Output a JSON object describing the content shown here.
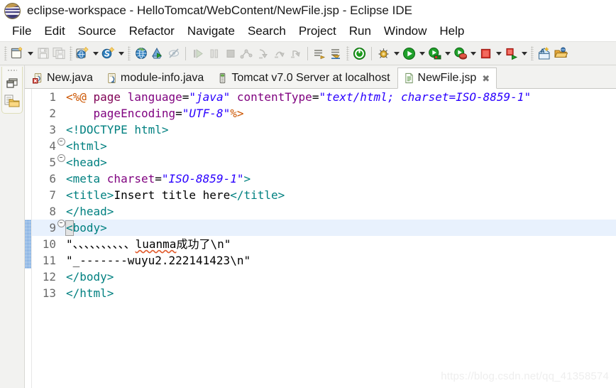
{
  "window": {
    "title": "eclipse-workspace - HelloTomcat/WebContent/NewFile.jsp - Eclipse IDE",
    "logo_name": "eclipse-logo"
  },
  "menubar": {
    "items": [
      {
        "label": "File"
      },
      {
        "label": "Edit"
      },
      {
        "label": "Source"
      },
      {
        "label": "Refactor"
      },
      {
        "label": "Navigate"
      },
      {
        "label": "Search"
      },
      {
        "label": "Project"
      },
      {
        "label": "Run"
      },
      {
        "label": "Window"
      },
      {
        "label": "Help"
      }
    ]
  },
  "toolbar": {
    "groups": [
      {
        "buttons": [
          {
            "icon": "new-wizard-icon",
            "enabled": true,
            "dropdown": true
          },
          {
            "icon": "save-icon",
            "enabled": false,
            "dropdown": false
          },
          {
            "icon": "save-all-icon",
            "enabled": false,
            "dropdown": false
          }
        ]
      },
      {
        "buttons": [
          {
            "icon": "new-jsp-file-icon",
            "enabled": true,
            "dropdown": true
          },
          {
            "icon": "new-servlet-icon",
            "enabled": true,
            "dropdown": true
          }
        ]
      },
      {
        "buttons": [
          {
            "icon": "open-web-browser-icon",
            "enabled": true,
            "dropdown": false
          },
          {
            "icon": "run-on-server-icon",
            "enabled": true,
            "dropdown": false
          },
          {
            "icon": "hide-annotations-icon",
            "enabled": false,
            "dropdown": false
          }
        ]
      },
      {
        "buttons": [
          {
            "icon": "resume-icon",
            "enabled": false,
            "dropdown": false
          },
          {
            "icon": "suspend-icon",
            "enabled": false,
            "dropdown": false
          },
          {
            "icon": "terminate-icon",
            "enabled": false,
            "dropdown": false
          },
          {
            "icon": "disconnect-icon",
            "enabled": false,
            "dropdown": false
          },
          {
            "icon": "step-into-icon",
            "enabled": false,
            "dropdown": false
          },
          {
            "icon": "step-over-icon",
            "enabled": false,
            "dropdown": false
          },
          {
            "icon": "step-return-icon",
            "enabled": false,
            "dropdown": false
          }
        ]
      },
      {
        "buttons": [
          {
            "icon": "next-annotation-icon",
            "enabled": true,
            "dropdown": false
          },
          {
            "icon": "previous-annotation-icon",
            "enabled": true,
            "dropdown": false
          }
        ]
      },
      {
        "buttons": [
          {
            "icon": "start-server-icon",
            "enabled": true,
            "dropdown": false
          }
        ]
      },
      {
        "buttons": [
          {
            "icon": "debug-icon",
            "enabled": true,
            "dropdown": true
          },
          {
            "icon": "run-icon",
            "enabled": true,
            "dropdown": true
          },
          {
            "icon": "run-server-icon",
            "enabled": true,
            "dropdown": true
          },
          {
            "icon": "profile-icon",
            "enabled": true,
            "dropdown": true
          },
          {
            "icon": "stop-icon",
            "enabled": true,
            "dropdown": true
          },
          {
            "icon": "publish-icon",
            "enabled": true,
            "dropdown": true
          }
        ]
      },
      {
        "buttons": [
          {
            "icon": "new-java-class-icon",
            "enabled": true,
            "dropdown": false
          },
          {
            "icon": "open-type-icon",
            "enabled": true,
            "dropdown": false
          }
        ]
      }
    ]
  },
  "leftbar": {
    "icons": [
      {
        "name": "restore-perspective-icon"
      },
      {
        "name": "project-explorer-icon"
      }
    ]
  },
  "tabs": [
    {
      "label": "New.java",
      "icon": "java-file-error-icon",
      "active": false,
      "closable": false
    },
    {
      "label": "module-info.java",
      "icon": "java-file-icon",
      "active": false,
      "closable": false
    },
    {
      "label": "Tomcat v7.0 Server at localhost",
      "icon": "server-icon",
      "active": false,
      "closable": false
    },
    {
      "label": "NewFile.jsp",
      "icon": "jsp-file-icon",
      "active": true,
      "closable": true,
      "close_glyph": "✖"
    }
  ],
  "editor": {
    "file": "NewFile.jsp",
    "cursor_line": 9,
    "highlight_line": 9,
    "change_bar_lines": [
      9,
      10,
      11
    ],
    "lines": [
      {
        "num": "1",
        "fold": false,
        "tokens": [
          {
            "t": "<%@ ",
            "c": "t-dirp"
          },
          {
            "t": "page",
            "c": "t-dir"
          },
          {
            "t": " ",
            "c": "t-plain"
          },
          {
            "t": "language",
            "c": "t-attr"
          },
          {
            "t": "=",
            "c": "t-plain"
          },
          {
            "t": "\"java\"",
            "c": "t-str"
          },
          {
            "t": " ",
            "c": "t-plain"
          },
          {
            "t": "contentType",
            "c": "t-attr"
          },
          {
            "t": "=",
            "c": "t-plain"
          },
          {
            "t": "\"text/html; charset=ISO-8859-1\"",
            "c": "t-str"
          }
        ]
      },
      {
        "num": "2",
        "fold": false,
        "tokens": [
          {
            "t": "    ",
            "c": "t-plain"
          },
          {
            "t": "pageEncoding",
            "c": "t-attr"
          },
          {
            "t": "=",
            "c": "t-plain"
          },
          {
            "t": "\"UTF-8\"",
            "c": "t-str"
          },
          {
            "t": "%>",
            "c": "t-dirp"
          }
        ]
      },
      {
        "num": "3",
        "fold": false,
        "tokens": [
          {
            "t": "<!DOCTYPE html>",
            "c": "t-doctype"
          }
        ]
      },
      {
        "num": "4",
        "fold": true,
        "tokens": [
          {
            "t": "<html>",
            "c": "t-tag"
          }
        ]
      },
      {
        "num": "5",
        "fold": true,
        "tokens": [
          {
            "t": "<head>",
            "c": "t-tag"
          }
        ]
      },
      {
        "num": "6",
        "fold": false,
        "tokens": [
          {
            "t": "<meta ",
            "c": "t-tag"
          },
          {
            "t": "charset",
            "c": "t-attr"
          },
          {
            "t": "=",
            "c": "t-plain"
          },
          {
            "t": "\"ISO-8859-1\"",
            "c": "t-str"
          },
          {
            "t": ">",
            "c": "t-tag"
          }
        ]
      },
      {
        "num": "7",
        "fold": false,
        "tokens": [
          {
            "t": "<title>",
            "c": "t-tag"
          },
          {
            "t": "Insert title here",
            "c": "t-plain"
          },
          {
            "t": "</title>",
            "c": "t-tag"
          }
        ]
      },
      {
        "num": "8",
        "fold": false,
        "tokens": [
          {
            "t": "</head>",
            "c": "t-tag"
          }
        ]
      },
      {
        "num": "9",
        "fold": true,
        "highlight": true,
        "cursor": true,
        "tokens": [
          {
            "t": "<",
            "c": "t-tag",
            "cursor": true
          },
          {
            "t": "body>",
            "c": "t-tag"
          }
        ]
      },
      {
        "num": "10",
        "fold": false,
        "tokens": [
          {
            "t": "\"、、、、、、、、、、",
            "c": "t-plain"
          },
          {
            "t": "luanma",
            "c": "t-plain",
            "squiggly": true
          },
          {
            "t": "成功了\\n\"",
            "c": "t-plain"
          }
        ]
      },
      {
        "num": "11",
        "fold": false,
        "tokens": [
          {
            "t": "\"_-------wuyu2.222141423\\n\"",
            "c": "t-plain"
          }
        ]
      },
      {
        "num": "12",
        "fold": false,
        "tokens": [
          {
            "t": "</body>",
            "c": "t-tag"
          }
        ]
      },
      {
        "num": "13",
        "fold": false,
        "tokens": [
          {
            "t": "</html>",
            "c": "t-tag"
          }
        ]
      }
    ]
  },
  "watermark": {
    "text": "https://blog.csdn.net/qq_41358574"
  },
  "colors": {
    "tag": "#008080",
    "attribute": "#7f007f",
    "string": "#2a00ff",
    "directive": "#7f0055",
    "directive_punct": "#cc5500",
    "highlight_line": "#e8f1fd",
    "change_bar": "#4f8ed6",
    "toolbar_bg": "#f0f0ee"
  }
}
